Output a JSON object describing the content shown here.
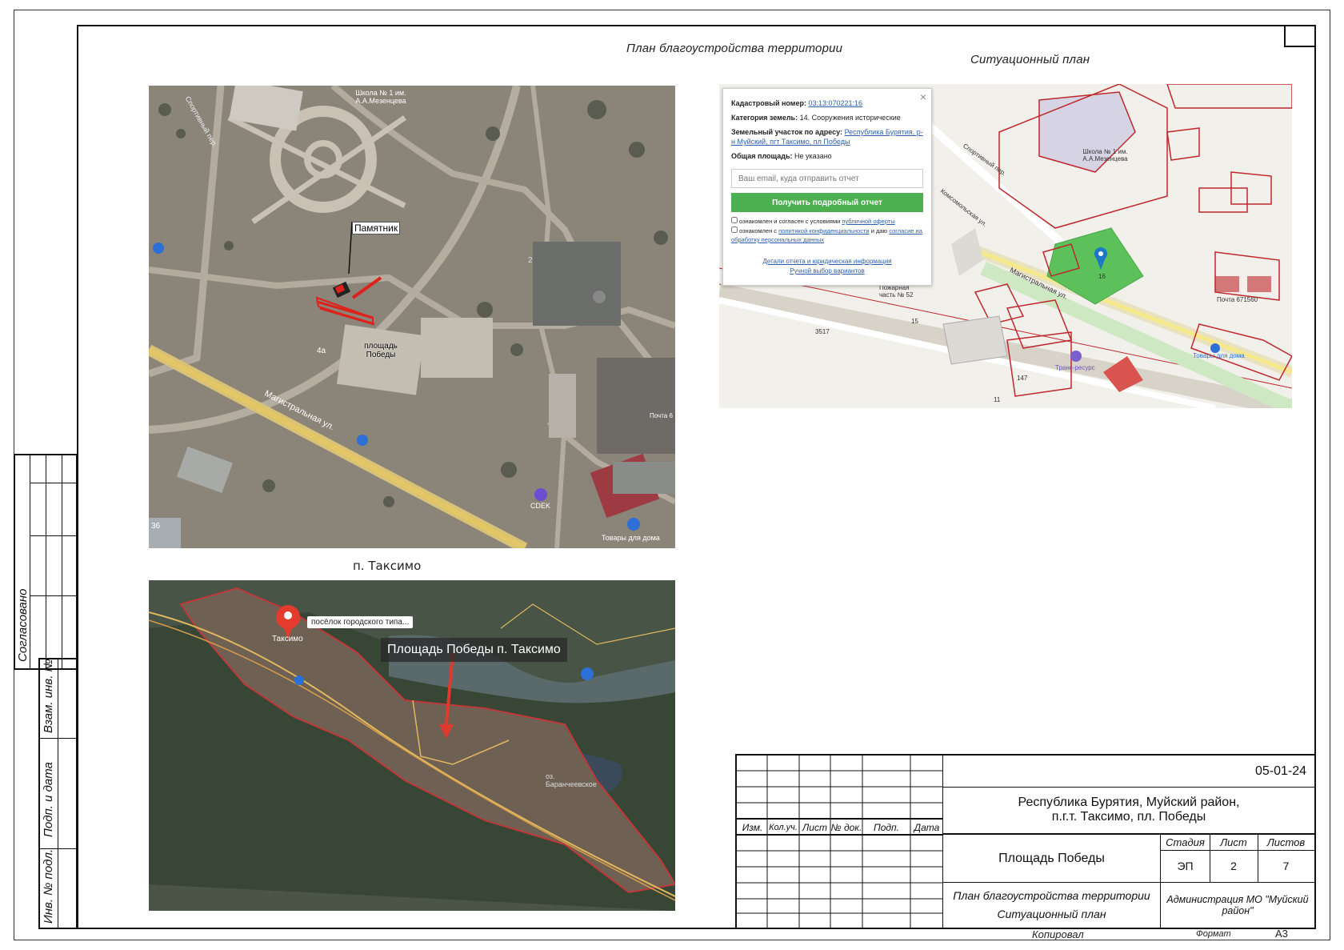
{
  "drawing": {
    "plan_caption": "План благоустройства территории",
    "situation_caption": "Ситуационный план",
    "village_caption": "п. Таксимо"
  },
  "stamp": {
    "agreed": "Согласовано",
    "replace_inv": "Взам. инв. №",
    "sign_date": "Подп. и дата",
    "inv_orig": "Инв. № подл."
  },
  "map1": {
    "monument_label": "Памятник",
    "school_label": "Школа № 1 им. А.А.Мезенцева",
    "square_label": "площадь Победы",
    "street_label": "Магистральная ул.",
    "cdek_label": "CDEK",
    "shop_label": "Товары для дома",
    "post_label": "Почта 6",
    "lane_label": "Спортивный пер.",
    "num_2": "2",
    "num_4a": "4а",
    "num_36": "36"
  },
  "map2": {
    "pin_tooltip": "посёлок городского типа...",
    "title_overlay": "Площадь Победы п. Таксимо",
    "town_label": "Таксимо",
    "lake_label": "оз. Баранчеевское"
  },
  "map3": {
    "cadastral_label": "Кадастровый номер:",
    "cadastral_value": "03:13:070221:16",
    "category_label": "Категория земель:",
    "category_value": "14. Сооружения исторические",
    "address_label": "Земельный участок по адресу:",
    "address_value": "Республика Бурятия, р-н Муйский, пгт Таксимо, пл Победы",
    "area_label": "Общая площадь:",
    "area_value": "Не указано",
    "email_placeholder": "Ваш email, куда отправить отчет",
    "report_button": "Получить подробный отчет",
    "check1_text": "ознакомлен и согласен с условиями",
    "check1_link": "публичной оферты",
    "check2_text": "ознакомлен с",
    "check2_link": "политикой конфиденциальности",
    "check2_text2": "и даю",
    "check2_link2": "согласие на обработку персональных данных",
    "details_link": "Детали отчета и юридическая информация",
    "manual_link": "Ручной выбор вариантов",
    "school_label": "Школа № 1 им. А.А.Мезенцева",
    "lane_label": "Спортивный пер.",
    "street1": "Комсомольская ул.",
    "street2": "Магистральная ул.",
    "post_label": "Почта 671560",
    "trans_label": "Транс-ресурс",
    "goods_label": "Товары для дома",
    "fire_label": "Пожарная часть № 52",
    "plot_16": "16",
    "plot_3517": "3517",
    "plot_147": "147",
    "plot_11": "11",
    "plot_15": "15"
  },
  "title_block": {
    "code": "05-01-24",
    "location_line1": "Республика Бурятия, Муйский район,",
    "location_line2": "п.г.т. Таксимо, пл. Победы",
    "object_name": "Площадь Победы",
    "sheet_title_line1": "План благоустройства территории",
    "sheet_title_line2": "Ситуационный план",
    "organization": "Администрация МО \"Муйский район\"",
    "col_izm": "Изм.",
    "col_kol": "Кол.уч.",
    "col_list": "Лист",
    "col_ndoc": "№ док.",
    "col_podp": "Подп.",
    "col_date": "Дата",
    "stage_h": "Стадия",
    "sheet_h": "Лист",
    "sheets_h": "Листов",
    "stage_v": "ЭП",
    "sheet_v": "2",
    "sheets_v": "7",
    "copied": "Копировал",
    "format_label": "Формат",
    "format_value": "А3"
  },
  "colors": {
    "satellite_ground": "#8a8378",
    "road_yellow": "#e3c665",
    "monument_red": "#e0201b",
    "map_green": "#4caf50",
    "cadastre_red": "#c0272d",
    "link_blue": "#2b5fad"
  }
}
